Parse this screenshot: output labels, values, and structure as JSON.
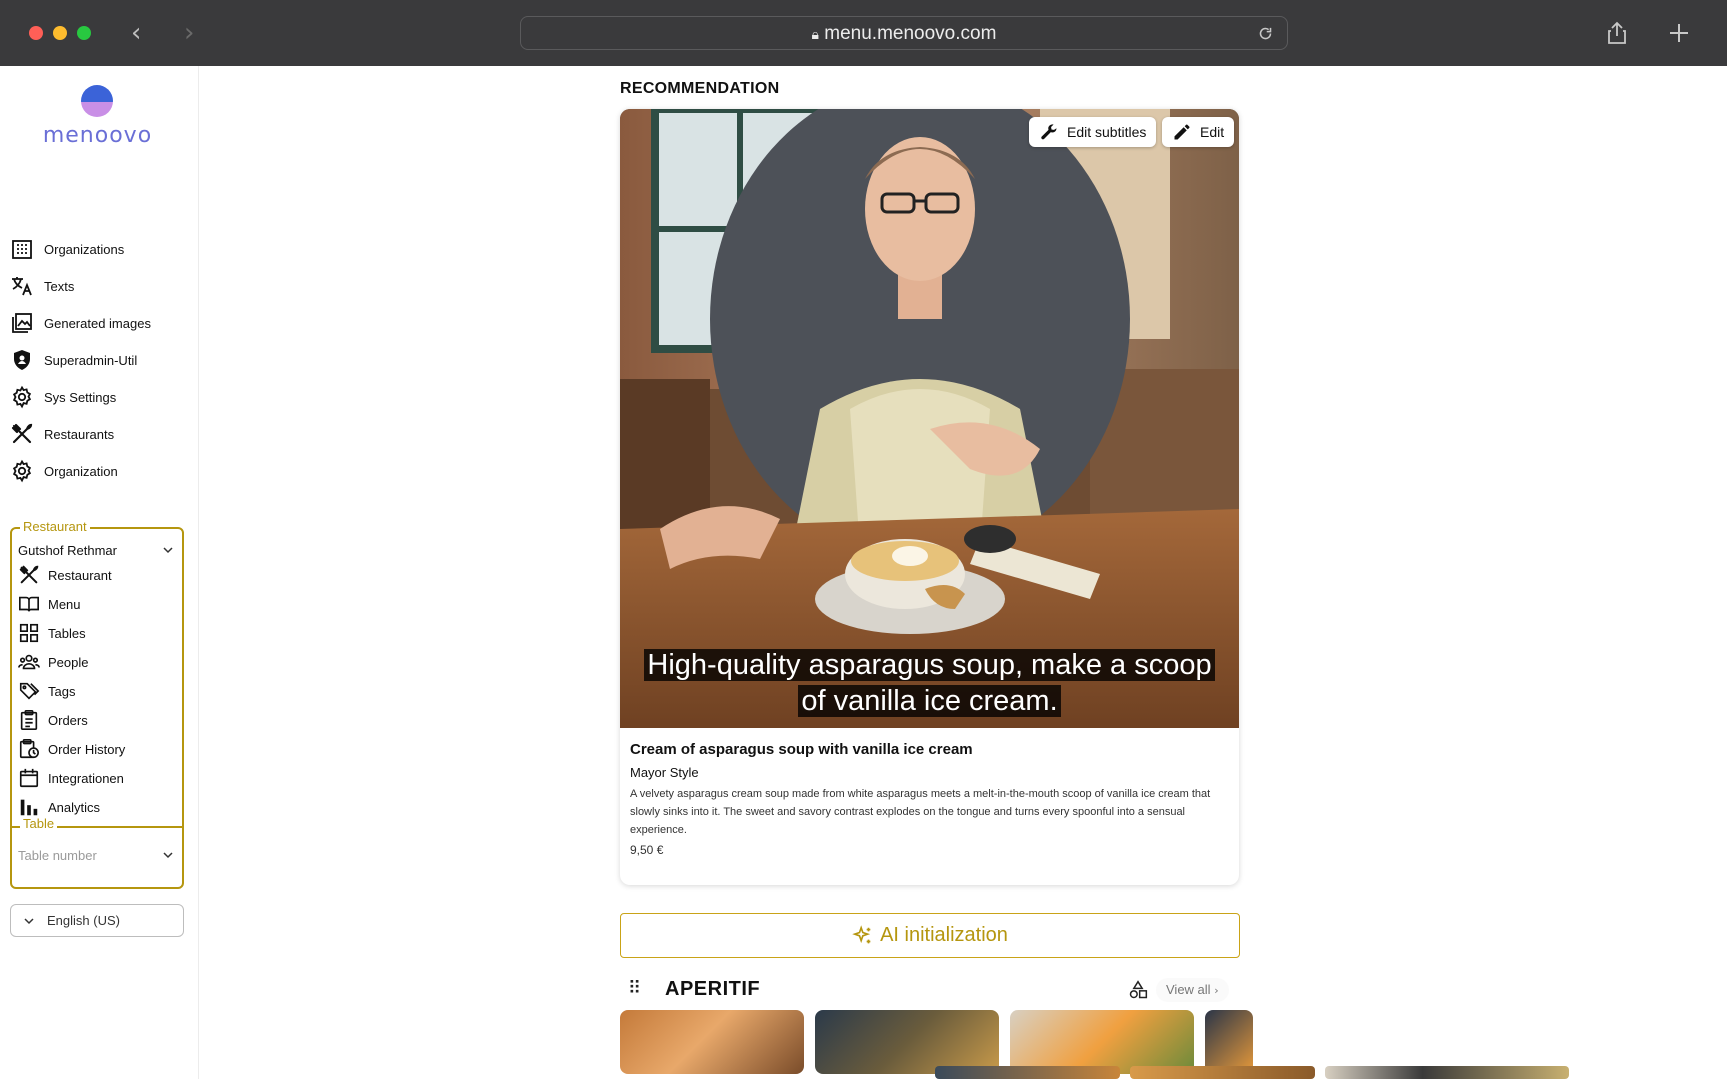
{
  "browser": {
    "url": "menu.menoovo.com"
  },
  "brand": {
    "logo_text": "menoovo",
    "accent": "#b5960f",
    "logo_color": "#6a6fd6"
  },
  "sidebar": {
    "items": [
      {
        "label": "Organizations",
        "icon": "building-icon"
      },
      {
        "label": "Texts",
        "icon": "translate-icon"
      },
      {
        "label": "Generated images",
        "icon": "image-library-icon"
      },
      {
        "label": "Superadmin-Util",
        "icon": "shield-icon"
      },
      {
        "label": "Sys Settings",
        "icon": "gear-icon"
      },
      {
        "label": "Restaurants",
        "icon": "cutlery-icon"
      },
      {
        "label": "Organization",
        "icon": "gear-icon"
      }
    ],
    "restaurant_group": {
      "legend": "Restaurant",
      "selected": "Gutshof Rethmar",
      "items": [
        {
          "label": "Restaurant",
          "icon": "cutlery-icon"
        },
        {
          "label": "Menu",
          "icon": "book-icon"
        },
        {
          "label": "Tables",
          "icon": "grid-icon"
        },
        {
          "label": "People",
          "icon": "people-icon"
        },
        {
          "label": "Tags",
          "icon": "tags-icon"
        },
        {
          "label": "Orders",
          "icon": "clipboard-icon"
        },
        {
          "label": "Order History",
          "icon": "history-icon"
        },
        {
          "label": "Integrationen",
          "icon": "calendar-icon"
        },
        {
          "label": "Analytics",
          "icon": "bar-chart-icon"
        }
      ],
      "table_legend": "Table",
      "table_placeholder": "Table number"
    },
    "language": "English (US)"
  },
  "main": {
    "section_title": "RECOMMENDATION",
    "video": {
      "edit_subtitles_label": "Edit subtitles",
      "edit_label": "Edit",
      "subtitle_line1": "High-quality asparagus soup, make a scoop",
      "subtitle_line2": "of vanilla ice cream."
    },
    "dish": {
      "title": "Cream of asparagus soup with vanilla ice cream",
      "subtitle": "Mayor Style",
      "description": "A velvety asparagus cream soup made from white asparagus meets a melt-in-the-mouth scoop of vanilla ice cream that slowly sinks into it. The sweet and savory contrast explodes on the tongue and turns every spoonful into a sensual experience.",
      "price": "9,50 €"
    },
    "ai_button": "AI initialization",
    "category": {
      "name": "APERITIF",
      "view_all": "View all"
    }
  }
}
